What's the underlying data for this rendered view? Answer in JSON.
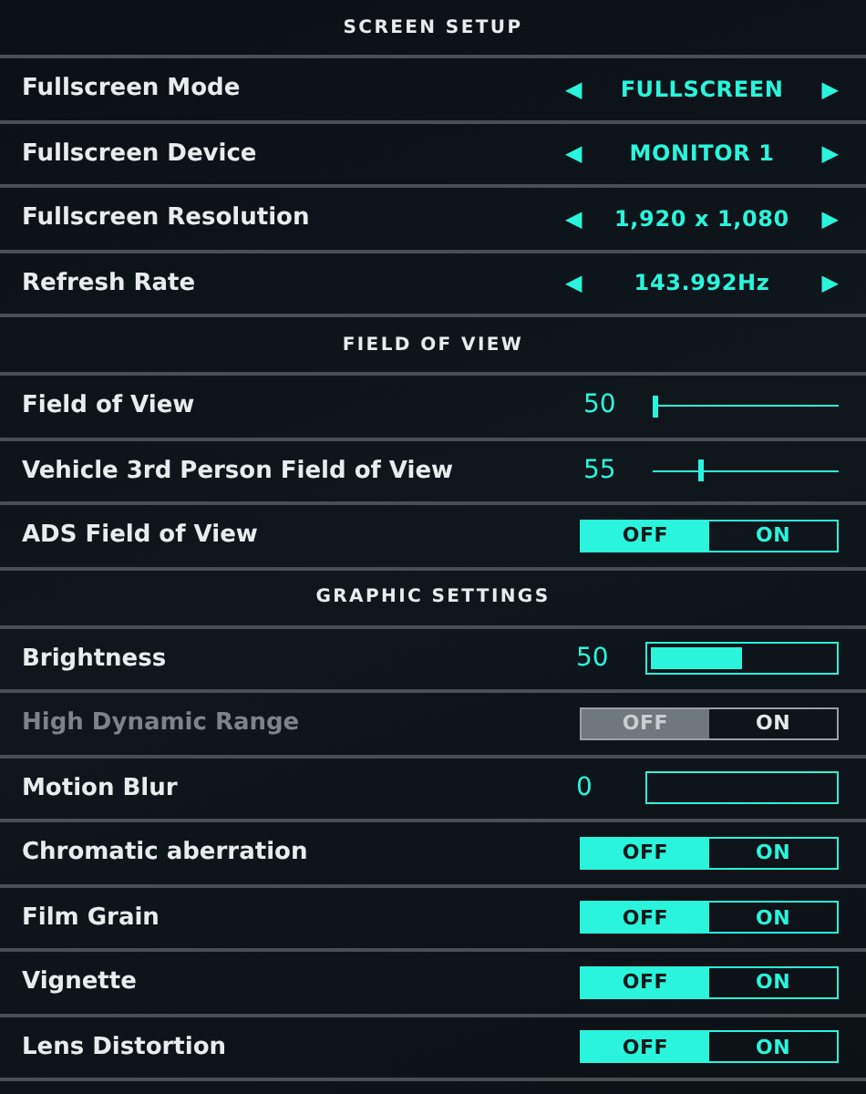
{
  "sections": [
    {
      "title": "SCREEN SETUP",
      "settings": [
        {
          "kind": "selector",
          "label": "Fullscreen Mode",
          "value": "FULLSCREEN",
          "prev": "◀",
          "next": "▶"
        },
        {
          "kind": "selector",
          "label": "Fullscreen Device",
          "value": "MONITOR 1",
          "prev": "◀",
          "next": "▶"
        },
        {
          "kind": "selector",
          "label": "Fullscreen Resolution",
          "value": "1,920 x 1,080",
          "prev": "◀",
          "next": "▶"
        },
        {
          "kind": "selector",
          "label": "Refresh Rate",
          "value": "143.992Hz",
          "prev": "◀",
          "next": "▶"
        }
      ]
    },
    {
      "title": "FIELD OF VIEW",
      "settings": [
        {
          "kind": "slider",
          "label": "Field of View",
          "value": "50",
          "level": 0.0
        },
        {
          "kind": "slider",
          "label": "Vehicle 3rd Person Field of View",
          "value": "55",
          "level": 0.25
        },
        {
          "kind": "toggle",
          "label": "ADS Field of View",
          "disabled": false,
          "options": [
            {
              "label": "OFF",
              "selected": true
            },
            {
              "label": "ON",
              "selected": false
            }
          ]
        }
      ]
    },
    {
      "title": "GRAPHIC SETTINGS",
      "settings": [
        {
          "kind": "bar",
          "label": "Brightness",
          "value": "50",
          "level": 0.5
        },
        {
          "kind": "toggle",
          "label": "High Dynamic Range",
          "disabled": true,
          "options": [
            {
              "label": "OFF",
              "selected": true
            },
            {
              "label": "ON",
              "selected": false
            }
          ]
        },
        {
          "kind": "bar",
          "label": "Motion Blur",
          "value": "0",
          "level": 0.0
        },
        {
          "kind": "toggle",
          "label": "Chromatic aberration",
          "disabled": false,
          "options": [
            {
              "label": "OFF",
              "selected": true
            },
            {
              "label": "ON",
              "selected": false
            }
          ]
        },
        {
          "kind": "toggle",
          "label": "Film Grain",
          "disabled": false,
          "options": [
            {
              "label": "OFF",
              "selected": true
            },
            {
              "label": "ON",
              "selected": false
            }
          ]
        },
        {
          "kind": "toggle",
          "label": "Vignette",
          "disabled": false,
          "options": [
            {
              "label": "OFF",
              "selected": true
            },
            {
              "label": "ON",
              "selected": false
            }
          ]
        },
        {
          "kind": "toggle",
          "label": "Lens Distortion",
          "disabled": false,
          "options": [
            {
              "label": "OFF",
              "selected": true
            },
            {
              "label": "ON",
              "selected": false
            }
          ]
        }
      ]
    }
  ]
}
